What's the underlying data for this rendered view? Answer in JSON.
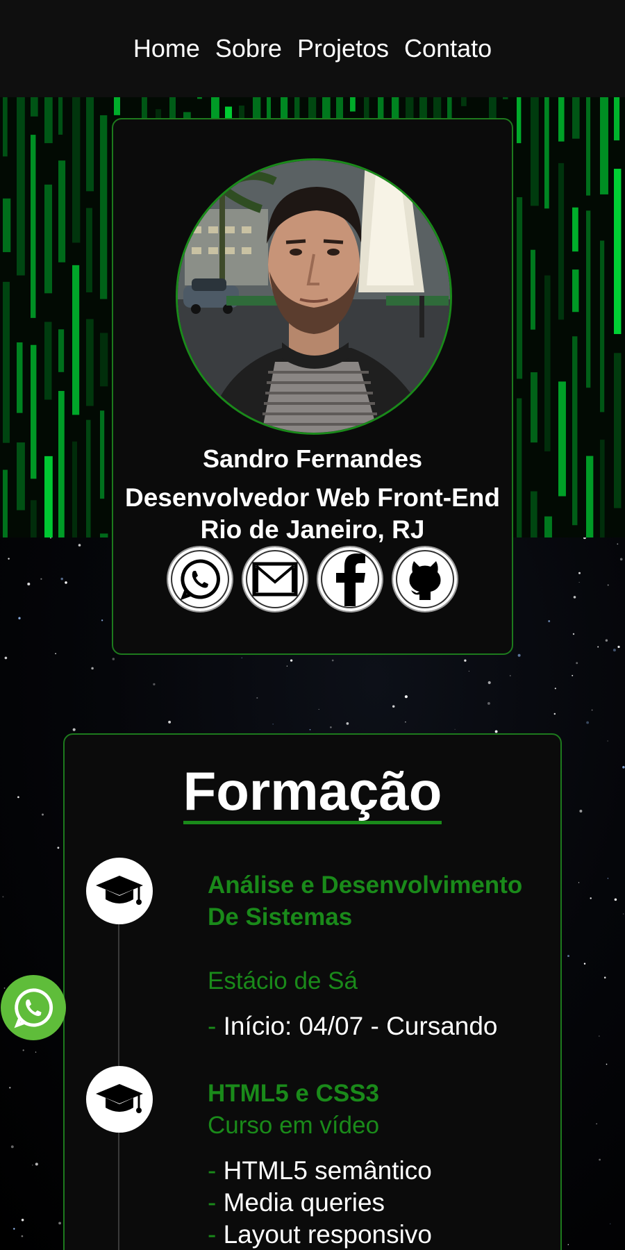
{
  "nav": {
    "items": [
      "Home",
      "Sobre",
      "Projetos",
      "Contato"
    ]
  },
  "profile": {
    "name": "Sandro Fernandes",
    "role": "Desenvolvedor Web Front-End",
    "location": "Rio de Janeiro, RJ",
    "socials": [
      {
        "icon": "whatsapp-icon"
      },
      {
        "icon": "gmail-icon"
      },
      {
        "icon": "facebook-icon"
      },
      {
        "icon": "github-icon"
      }
    ]
  },
  "education": {
    "title": "Formação",
    "items": [
      {
        "icon": "graduation-cap-icon",
        "title": "Análise e Desenvolvimento De Sistemas",
        "institution": "Estácio de Sá",
        "details": [
          "Início: 04/07 - Cursando"
        ]
      },
      {
        "icon": "graduation-cap-icon",
        "title": "HTML5 e CSS3",
        "institution": "Curso em vídeo",
        "details": [
          "HTML5 semântico",
          "Media queries",
          "Layout responsivo"
        ]
      }
    ]
  },
  "floating_button": {
    "icon": "whatsapp-icon"
  },
  "colors": {
    "accent": "#1a8a1a",
    "card_background": "#0b0b0b",
    "nav_background": "#0f0f0f",
    "whatsapp": "#5fbd3a"
  }
}
